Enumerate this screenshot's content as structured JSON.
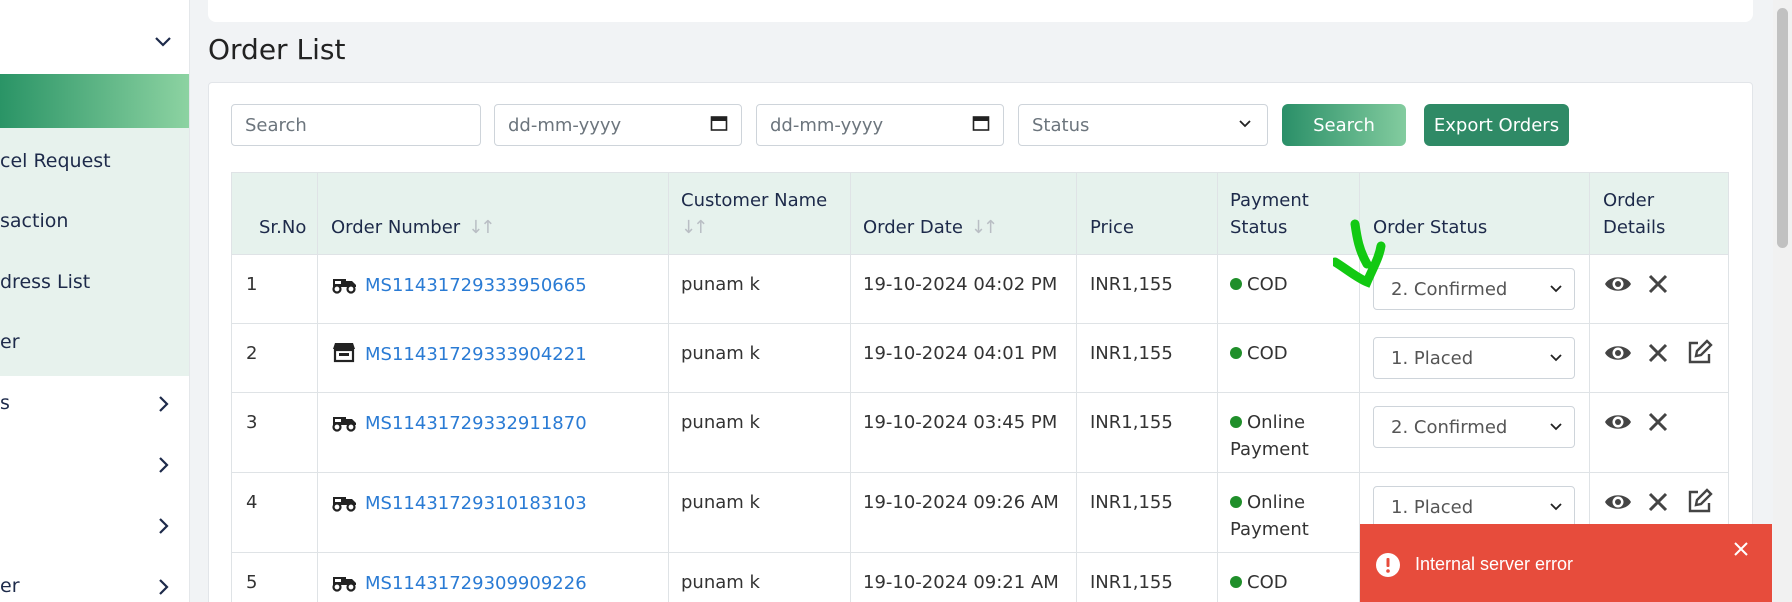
{
  "sidebar": {
    "items": [
      {
        "label": "cel Request"
      },
      {
        "label": "saction"
      },
      {
        "label": "dress List"
      },
      {
        "label": "er"
      }
    ],
    "collapsed": [
      {
        "label": "s"
      },
      {
        "label": ""
      },
      {
        "label": ""
      },
      {
        "label": "er"
      }
    ]
  },
  "page": {
    "title": "Order List"
  },
  "filters": {
    "search_placeholder": "Search",
    "date_from": "dd-mm-yyyy",
    "date_to": "dd-mm-yyyy",
    "status": "Status",
    "search_button": "Search",
    "export_button": "Export Orders"
  },
  "table": {
    "headers": {
      "srno": "Sr.No",
      "order_number": "Order Number",
      "customer_name": "Customer Name",
      "order_date": "Order Date",
      "price": "Price",
      "payment_status_1": "Payment",
      "payment_status_2": "Status",
      "order_status": "Order Status",
      "order_details_1": "Order",
      "order_details_2": "Details"
    },
    "rows": [
      {
        "srno": "1",
        "icon": "truck-icon",
        "order_number": "MS11431729333950665",
        "customer": "punam k",
        "date": "19-10-2024 04:02 PM",
        "price": "INR1,155",
        "payment_1": "COD",
        "payment_2": "",
        "status": "2. Confirmed"
      },
      {
        "srno": "2",
        "icon": "store-icon",
        "order_number": "MS11431729333904221",
        "customer": "punam k",
        "date": "19-10-2024 04:01 PM",
        "price": "INR1,155",
        "payment_1": "COD",
        "payment_2": "",
        "status": "1. Placed"
      },
      {
        "srno": "3",
        "icon": "truck-icon",
        "order_number": "MS11431729332911870",
        "customer": "punam k",
        "date": "19-10-2024 03:45 PM",
        "price": "INR1,155",
        "payment_1": "Online",
        "payment_2": "Payment",
        "status": "2. Confirmed"
      },
      {
        "srno": "4",
        "icon": "truck-icon",
        "order_number": "MS11431729310183103",
        "customer": "punam k",
        "date": "19-10-2024 09:26 AM",
        "price": "INR1,155",
        "payment_1": "Online",
        "payment_2": "Payment",
        "status": "1. Placed"
      },
      {
        "srno": "5",
        "icon": "truck-icon",
        "order_number": "MS11431729309909226",
        "customer": "punam k",
        "date": "19-10-2024 09:21 AM",
        "price": "INR1,155",
        "payment_1": "COD",
        "payment_2": "",
        "status": ""
      }
    ]
  },
  "toast": {
    "message": "Internal server error"
  },
  "colors": {
    "accent": "#2a8f68",
    "link": "#2a7bd4",
    "toast": "#e74c3c",
    "payment_dot": "#1f8f2a"
  }
}
